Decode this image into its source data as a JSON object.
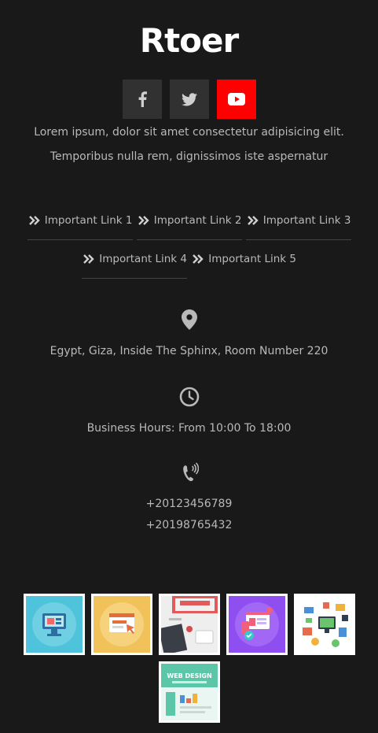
{
  "brand": {
    "name": "Rtoer"
  },
  "social": [
    {
      "name": "facebook",
      "icon": "facebook-icon",
      "color": "#313131"
    },
    {
      "name": "twitter",
      "icon": "twitter-icon",
      "color": "#313131"
    },
    {
      "name": "youtube",
      "icon": "youtube-icon",
      "color": "#ff0000"
    }
  ],
  "description": "Lorem ipsum, dolor sit amet consectetur adipisicing elit. Temporibus nulla rem, dignissimos iste aspernatur",
  "links": [
    {
      "label": "Important Link 1"
    },
    {
      "label": "Important Link 2"
    },
    {
      "label": "Important Link 3"
    },
    {
      "label": "Important Link 4"
    },
    {
      "label": "Important Link 5"
    }
  ],
  "contact": {
    "address": "Egypt, Giza, Inside The Sphinx, Room Number 220",
    "hours": "Business Hours: From 10:00 To 18:00",
    "phone1": "+20123456789",
    "phone2": "+20198765432"
  },
  "gallery": [
    {
      "icon": "desktop-illustration-icon",
      "bg": "#4fc3dc"
    },
    {
      "icon": "browser-cursor-illustration-icon",
      "bg": "#f1c15a"
    },
    {
      "icon": "desk-photo-icon",
      "bg": "#e9e9e9"
    },
    {
      "icon": "web-security-illustration-icon",
      "bg": "#8f4ff0"
    },
    {
      "icon": "network-devices-illustration-icon",
      "bg": "#ffffff"
    },
    {
      "icon": "web-design-illustration-icon",
      "bg": "#ffffff",
      "caption": "WEB DESIGN"
    }
  ],
  "colors": {
    "background": "#191919",
    "text": "#b9b9b9",
    "title": "#ffffff",
    "youtube": "#ff0000"
  }
}
